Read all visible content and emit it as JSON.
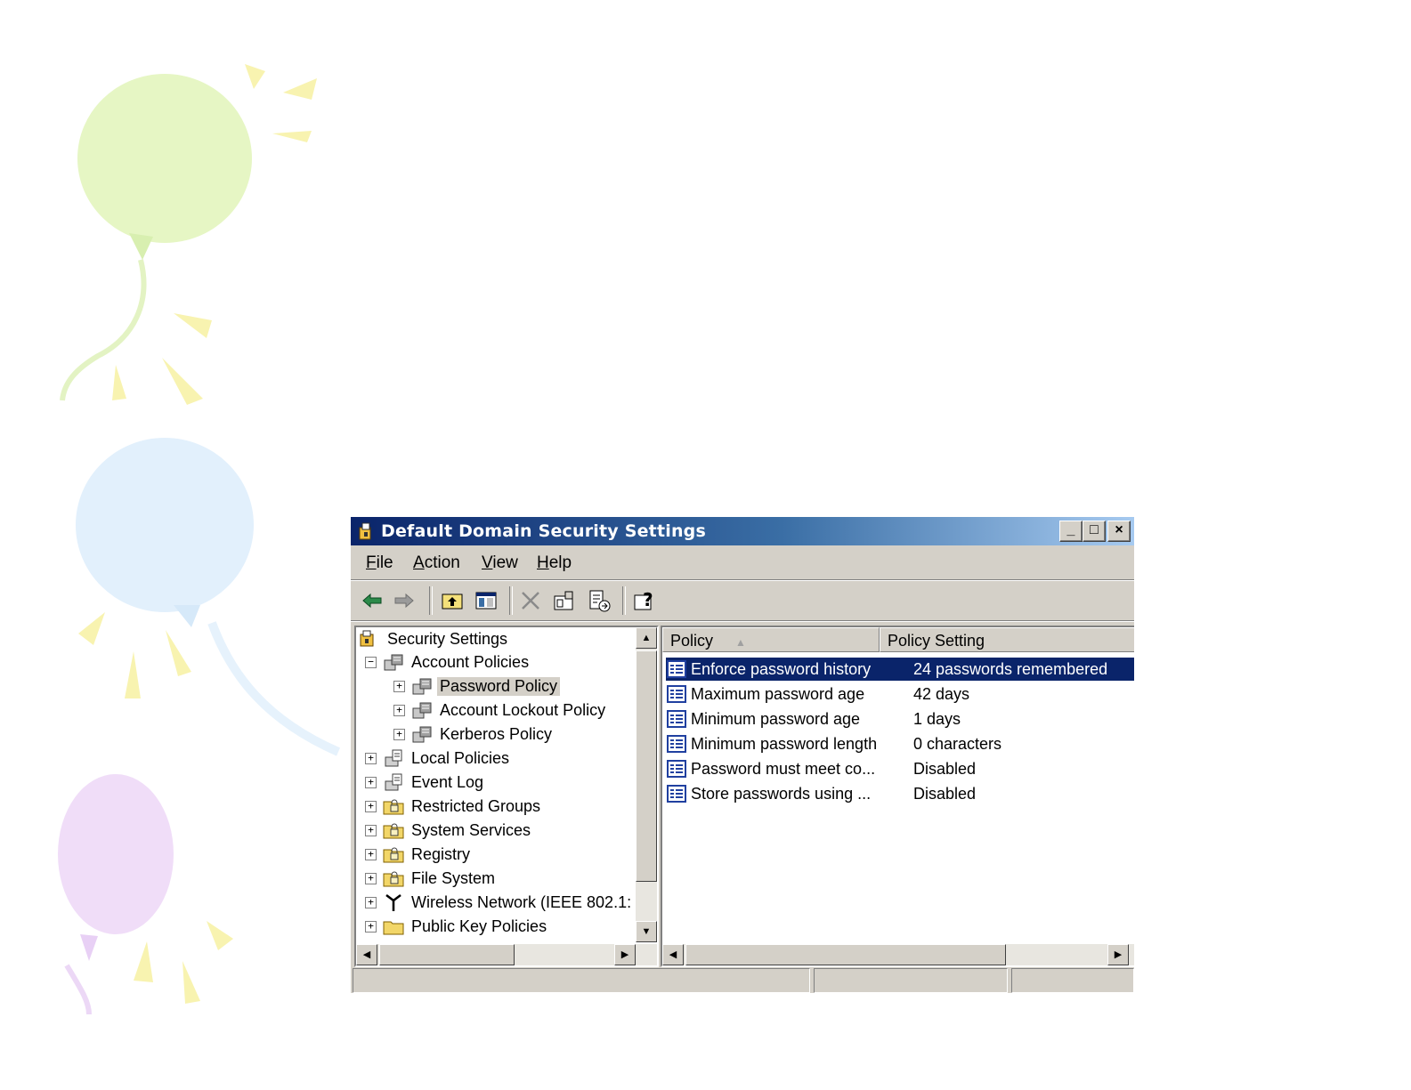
{
  "window": {
    "title": "Default Domain Security Settings",
    "controls": {
      "minimize": "_",
      "maximize": "□",
      "close": "×"
    }
  },
  "menu": [
    {
      "label": "File",
      "accelerator": "F",
      "rest": "ile"
    },
    {
      "label": "Action",
      "accelerator": "A",
      "rest": "ction"
    },
    {
      "label": "View",
      "accelerator": "V",
      "rest": "iew"
    },
    {
      "label": "Help",
      "accelerator": "H",
      "rest": "elp"
    }
  ],
  "toolbar": {
    "icons": [
      "back-arrow-icon",
      "forward-arrow-icon",
      "up-one-level-icon",
      "show-hide-console-tree-icon",
      "delete-icon",
      "properties-icon",
      "export-list-icon",
      "help-icon"
    ]
  },
  "tree": {
    "items": [
      {
        "label": "Security Settings",
        "icon": "security-settings-icon"
      },
      {
        "label": "Account Policies",
        "icon": "policy-folder-icon",
        "expander": "−"
      },
      {
        "label": "Password Policy",
        "icon": "policy-folder-icon",
        "expander": "+",
        "selected": true
      },
      {
        "label": "Account Lockout Policy",
        "icon": "policy-folder-icon",
        "expander": "+"
      },
      {
        "label": "Kerberos Policy",
        "icon": "policy-folder-icon",
        "expander": "+"
      },
      {
        "label": "Local Policies",
        "icon": "computer-policy-icon",
        "expander": "+"
      },
      {
        "label": "Event Log",
        "icon": "computer-policy-icon",
        "expander": "+"
      },
      {
        "label": "Restricted Groups",
        "icon": "locked-folder-icon",
        "expander": "+"
      },
      {
        "label": "System Services",
        "icon": "locked-folder-icon",
        "expander": "+"
      },
      {
        "label": "Registry",
        "icon": "locked-folder-icon",
        "expander": "+"
      },
      {
        "label": "File System",
        "icon": "locked-folder-icon",
        "expander": "+"
      },
      {
        "label": "Wireless Network (IEEE 802.1:",
        "icon": "antenna-icon",
        "expander": "+"
      },
      {
        "label": "Public Key Policies",
        "icon": "folder-icon",
        "expander": "+"
      }
    ]
  },
  "list": {
    "columns": [
      "Policy",
      "Policy Setting"
    ],
    "rows": [
      {
        "policy": "Enforce password history",
        "setting": "24 passwords remembered",
        "selected": true
      },
      {
        "policy": "Maximum password age",
        "setting": "42 days"
      },
      {
        "policy": "Minimum password age",
        "setting": "1 days"
      },
      {
        "policy": "Minimum password length",
        "setting": "0 characters"
      },
      {
        "policy": "Password must meet co...",
        "setting": "Disabled"
      },
      {
        "policy": "Store passwords using ...",
        "setting": "Disabled"
      }
    ]
  },
  "colors": {
    "titlebar_start": "#0a246a",
    "titlebar_end": "#a6caf0",
    "window_face": "#d4d0c8",
    "selection": "#0a246a"
  }
}
